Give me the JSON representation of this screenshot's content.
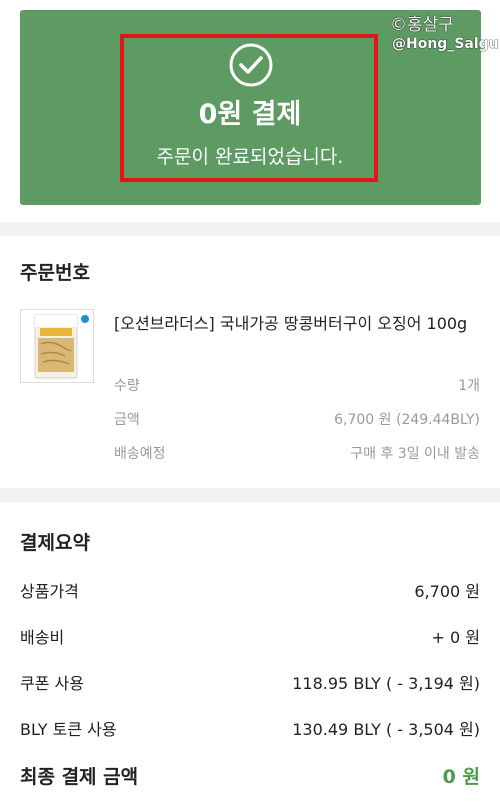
{
  "banner": {
    "title": "0원 결제",
    "message": "주문이 완료되었습니다."
  },
  "watermark": {
    "name": "©홍살구",
    "handle": "@Hong_Salgu"
  },
  "order": {
    "section_title": "주문번호",
    "product_name": "[오션브라더스] 국내가공 땅콩버터구이 오징어 100g",
    "details": [
      {
        "label": "수량",
        "value": "1개"
      },
      {
        "label": "금액",
        "value": "6,700 원 (249.44BLY)"
      },
      {
        "label": "배송예정",
        "value": "구매 후 3일 이내 발송"
      }
    ]
  },
  "summary": {
    "section_title": "결제요약",
    "rows": [
      {
        "label": "상품가격",
        "value": "6,700 원"
      },
      {
        "label": "배송비",
        "value": "+ 0 원"
      },
      {
        "label": "쿠폰 사용",
        "value": "118.95 BLY ( - 3,194 원)"
      },
      {
        "label": "BLY 토큰 사용",
        "value": "130.49 BLY ( - 3,504 원)"
      }
    ],
    "final_label": "최종 결제 금액",
    "final_value": "0 원"
  },
  "colors": {
    "banner": "#5e9b62",
    "highlight": "#e0161b",
    "final_accent": "#4c9a4e"
  },
  "icons": {
    "banner": "check-circle-icon"
  }
}
